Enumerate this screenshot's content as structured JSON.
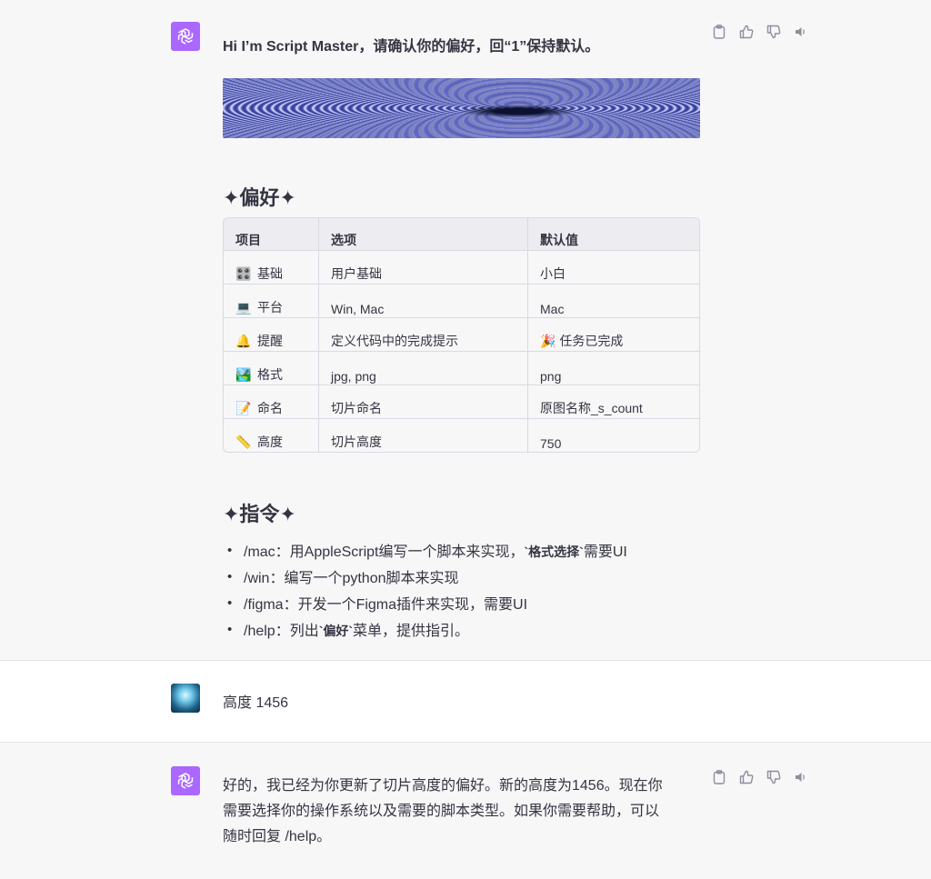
{
  "messages": {
    "first": {
      "intro": "Hi I’m Script Master，请确认你的偏好，回“1”保持默认。",
      "pref_heading": "✦偏好✦",
      "table": {
        "headers": [
          "项目",
          "选项",
          "默认值"
        ],
        "rows": [
          {
            "emoji": "🎛️",
            "item": "基础",
            "option": "用户基础",
            "default": "小白"
          },
          {
            "emoji": "💻",
            "item": "平台",
            "option": "Win, Mac",
            "default": "Mac"
          },
          {
            "emoji": "🔔",
            "item": "提醒",
            "option": "定义代码中的完成提示",
            "default": "🎉 任务已完成"
          },
          {
            "emoji": "🏞️",
            "item": "格式",
            "option": "jpg, png",
            "default": "png"
          },
          {
            "emoji": "📝",
            "item": "命名",
            "option": "切片命名",
            "default": "原图名称_s_count"
          },
          {
            "emoji": "📏",
            "item": "高度",
            "option": "切片高度",
            "default": "750"
          }
        ]
      },
      "cmd_heading": "✦指令✦",
      "commands": [
        {
          "pre": "/mac：用AppleScript编写一个脚本来实现，",
          "code": "`格式选择`",
          "post": "需要UI"
        },
        {
          "pre": "/win：编写一个python脚本来实现",
          "code": "",
          "post": ""
        },
        {
          "pre": "/figma：开发一个Figma插件来实现，需要UI",
          "code": "",
          "post": ""
        },
        {
          "pre": "/help：列出",
          "code": "`偏好`",
          "post": "菜单，提供指引。"
        }
      ]
    },
    "user": {
      "text": "高度 1456"
    },
    "second": {
      "line1": "好的，我已经为你更新了切片高度的偏好。新的高度为1456。现在你",
      "line2": "需要选择你的操作系统以及需要的脚本类型。如果你需要帮助，可以",
      "line3": "随时回复 /help。"
    }
  },
  "icons": {
    "assistant_avatar": "openai-logo-icon",
    "copy": "clipboard-icon",
    "like": "thumbs-up-icon",
    "dislike": "thumbs-down-icon",
    "speak": "speaker-icon"
  },
  "colors": {
    "assistant_avatar_bg": "#ab68ff",
    "page_bg": "#f7f7f8",
    "user_bg": "#ffffff"
  }
}
